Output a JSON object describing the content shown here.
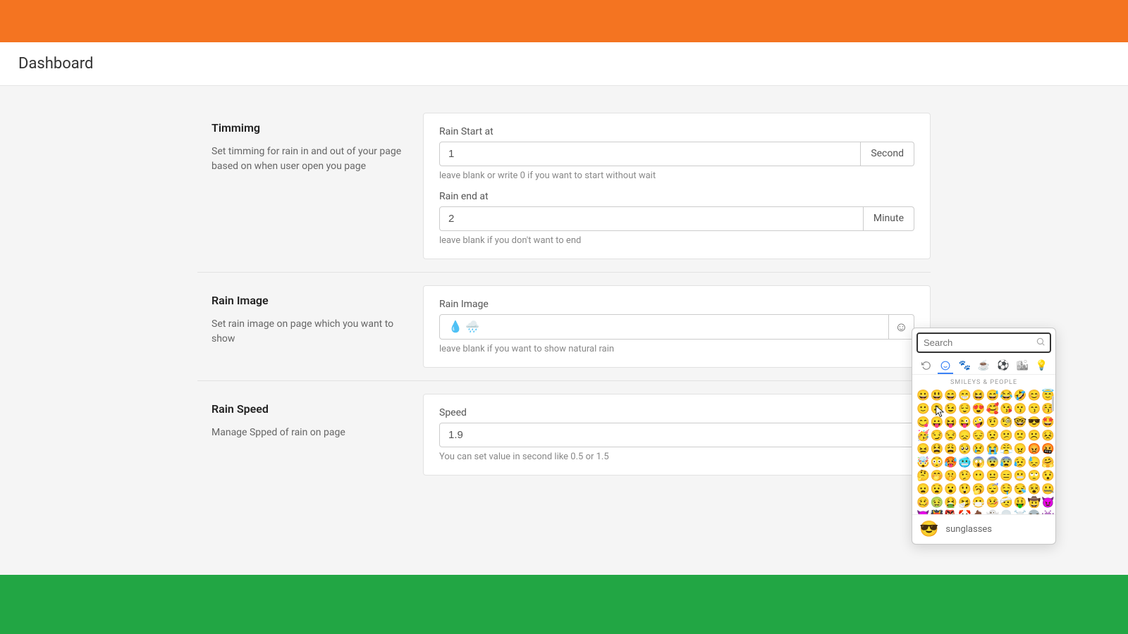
{
  "header": {
    "title": "Dashboard"
  },
  "sections": {
    "timing": {
      "title": "Timmimg",
      "desc": "Set timming for rain in and out of your page based on when user open you page",
      "start_label": "Rain Start at",
      "start_value": "1",
      "start_unit": "Second",
      "start_help": "leave blank or write 0 if you want to start without wait",
      "end_label": "Rain end at",
      "end_value": "2",
      "end_unit": "Minute",
      "end_help": "leave blank if you don't want to end"
    },
    "image": {
      "title": "Rain Image",
      "desc": "Set rain image on page which you want to show",
      "label": "Rain Image",
      "value": "💧 🌧️",
      "help": "leave blank if you want to show natural rain"
    },
    "speed": {
      "title": "Rain Speed",
      "desc": "Manage Spped of rain on page",
      "label": "Speed",
      "value": "1.9",
      "help": "You can set value in second like 0.5 or 1.5"
    }
  },
  "emoji_picker": {
    "search_placeholder": "Search",
    "category_title": "SMILEYS & PEOPLE",
    "preview_emoji": "😎",
    "preview_name": "sunglasses",
    "grid": [
      "😀",
      "😃",
      "😄",
      "😁",
      "😆",
      "😅",
      "😂",
      "🤣",
      "😊",
      "😇",
      "🙂",
      "🙃",
      "😉",
      "😌",
      "😍",
      "🥰",
      "😘",
      "😗",
      "😙",
      "😚",
      "😋",
      "😛",
      "😝",
      "😜",
      "🤪",
      "🤨",
      "🧐",
      "🤓",
      "😎",
      "🤩",
      "🥳",
      "😏",
      "😒",
      "😞",
      "😔",
      "😟",
      "😕",
      "🙁",
      "☹️",
      "😣",
      "😖",
      "😫",
      "😩",
      "🥺",
      "😢",
      "😭",
      "😤",
      "😠",
      "😡",
      "🤬",
      "🤯",
      "😳",
      "🥵",
      "🥶",
      "😱",
      "😨",
      "😰",
      "😥",
      "😓",
      "🤗",
      "🤔",
      "🤭",
      "🤫",
      "🤥",
      "😶",
      "😐",
      "😑",
      "😬",
      "🙄",
      "😯",
      "😦",
      "😧",
      "😮",
      "😲",
      "🥱",
      "😴",
      "🤤",
      "😪",
      "😵",
      "🤐",
      "🥴",
      "🤢",
      "🤮",
      "🤧",
      "😷",
      "🤒",
      "🤕",
      "🤑",
      "🤠",
      "😈",
      "👿",
      "👹",
      "👺",
      "🤡",
      "💩",
      "👻",
      "💀",
      "☠️",
      "👽",
      "👾"
    ]
  }
}
